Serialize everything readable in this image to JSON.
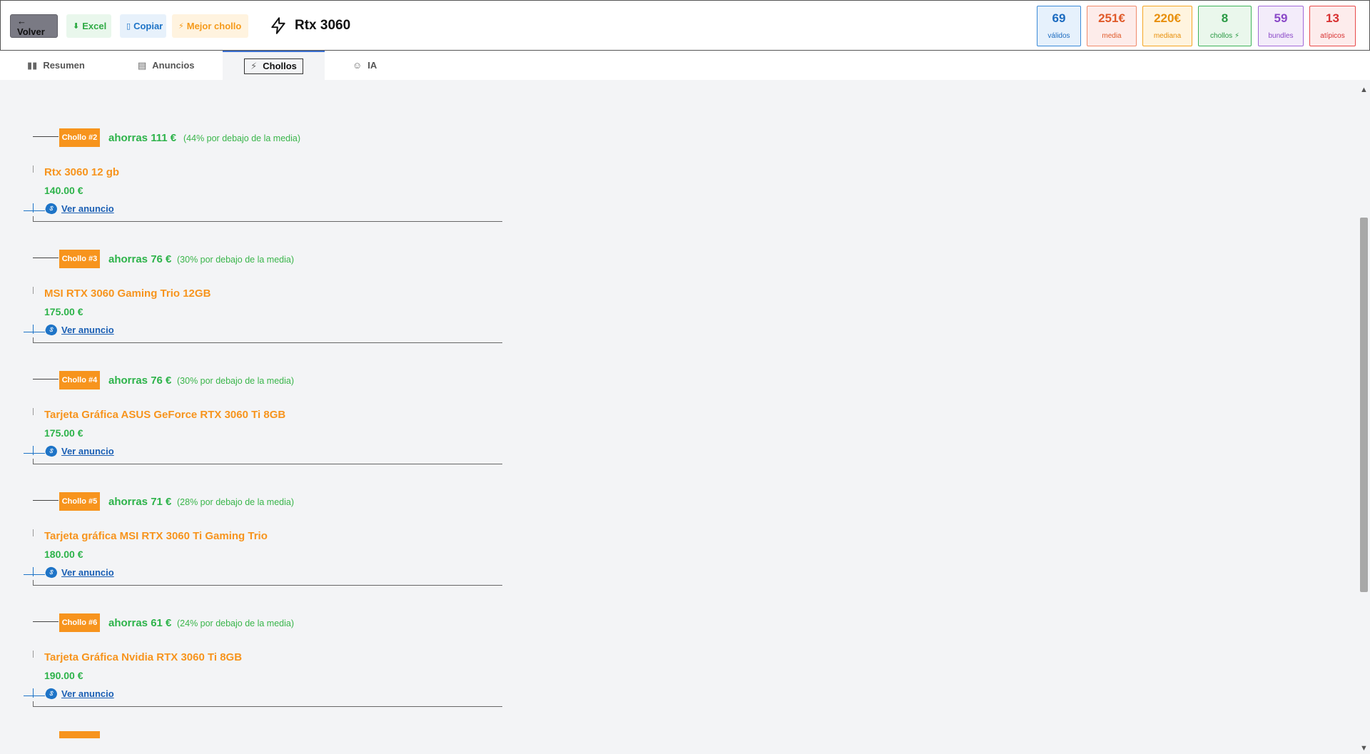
{
  "header": {
    "back_label": "← Volver",
    "excel_label": "Excel",
    "copy_label": "Copiar",
    "best_label": "Mejor chollo",
    "title": "Rtx 3060"
  },
  "stats": [
    {
      "value": "69",
      "label": "válidos"
    },
    {
      "value": "251€",
      "label": "media"
    },
    {
      "value": "220€",
      "label": "mediana"
    },
    {
      "value": "8",
      "label": "chollos"
    },
    {
      "value": "59",
      "label": "bundles"
    },
    {
      "value": "13",
      "label": "atípicos"
    }
  ],
  "tabs": [
    {
      "label": "Resumen",
      "icon": "chart-icon"
    },
    {
      "label": "Anuncios",
      "icon": "clipboard-icon"
    },
    {
      "label": "Chollos",
      "icon": "lightning-icon",
      "active": true
    },
    {
      "label": "IA",
      "icon": "robot-icon"
    }
  ],
  "deals": [
    {
      "badge": "Chollo #2",
      "save": "ahorras 111 €",
      "pct": "(44% por debajo de la media)",
      "name": "Rtx 3060 12 gb",
      "price": "140.00 €",
      "link": "Ver anuncio"
    },
    {
      "badge": "Chollo #3",
      "save": "ahorras 76 €",
      "pct": "(30% por debajo de la media)",
      "name": "MSI RTX 3060 Gaming Trio 12GB",
      "price": "175.00 €",
      "link": "Ver anuncio"
    },
    {
      "badge": "Chollo #4",
      "save": "ahorras 76 €",
      "pct": "(30% por debajo de la media)",
      "name": "Tarjeta Gráfica ASUS GeForce RTX 3060 Ti 8GB",
      "price": "175.00 €",
      "link": "Ver anuncio"
    },
    {
      "badge": "Chollo #5",
      "save": "ahorras 71 €",
      "pct": "(28% por debajo de la media)",
      "name": "Tarjeta gráfica MSI RTX 3060 Ti Gaming Trio",
      "price": "180.00 €",
      "link": "Ver anuncio"
    },
    {
      "badge": "Chollo #6",
      "save": "ahorras 61 €",
      "pct": "(24% por debajo de la media)",
      "name": "Tarjeta Gráfica Nvidia RTX 3060 Ti 8GB",
      "price": "190.00 €",
      "link": "Ver anuncio"
    }
  ],
  "colors": {
    "accent_orange": "#f7941d",
    "accent_green": "#2db34a",
    "link_blue": "#1a5fb4"
  }
}
